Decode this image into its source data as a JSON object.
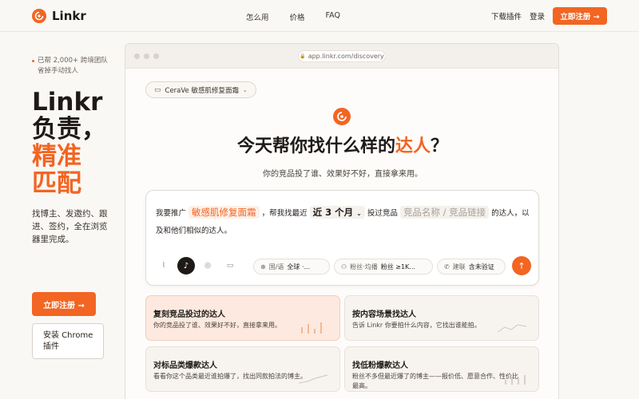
{
  "nav": {
    "brand": "Linkr",
    "links": [
      "怎么用",
      "价格",
      "FAQ"
    ],
    "download": "下载插件",
    "login": "登录",
    "cta": "立即注册 →"
  },
  "hero": {
    "tagline": "已帮 2,000+ 跨境团队省掉手动找人",
    "title_line1": "Linkr",
    "title_line2": "负责，",
    "title_line3": "精准",
    "title_line4": "匹配",
    "description": "找博主、发邀约、跟进、签约，全在浏览器里完成。",
    "cta_primary": "立即注册 →",
    "cta_secondary": "安装 Chrome 插件"
  },
  "browser": {
    "url": "app.linkr.com/discovery",
    "product_selector": "CeraVe 敏感肌修复面霜",
    "headline_pre": "今天帮你找什么样的",
    "headline_highlight": "达人",
    "headline_post": "？",
    "subline": "你的竞品投了谁、效果好不好，直接拿来用。",
    "composer": {
      "s1": "我要推广",
      "product_value": "敏感肌修复面霜",
      "s2": "，帮我找最近",
      "period_value": "近 3 个月",
      "s3": "投过竞品",
      "competitor_placeholder": "竞品名称 / 竞品链接",
      "s4": "的达人，以及和他们相似的达人。",
      "filters": [
        {
          "label": "国/语",
          "value": "全球 ·..."
        },
        {
          "label": "粉丝·均播",
          "value": "粉丝 ≥1K..."
        },
        {
          "label": "建联",
          "value": "含未验证"
        }
      ]
    },
    "cards": [
      {
        "title": "复刻竞品投过的达人",
        "desc": "你的竞品投了谁、效果好不好，直接拿来用。",
        "active": true
      },
      {
        "title": "按内容场景找达人",
        "desc": "告诉 Linkr 你要拍什么内容，它找出谁能拍。",
        "active": false
      },
      {
        "title": "对标品类爆款达人",
        "desc": "看看你这个品类最近谁拍爆了，找出同款拍法的博主。",
        "active": false
      },
      {
        "title": "找低粉爆款达人",
        "desc": "粉丝不多但最近爆了的博主——报价低、愿意合作、性价比最高。",
        "active": false
      }
    ]
  },
  "colors": {
    "accent": "#f26522",
    "background": "#faf8f5"
  },
  "icons": [
    "logo-icon",
    "lock-icon",
    "folder-icon",
    "chevron-down-icon",
    "paperclip-icon",
    "tiktok-icon",
    "instagram-icon",
    "youtube-icon",
    "globe-icon",
    "followers-icon",
    "contact-icon",
    "send-arrow-icon"
  ]
}
